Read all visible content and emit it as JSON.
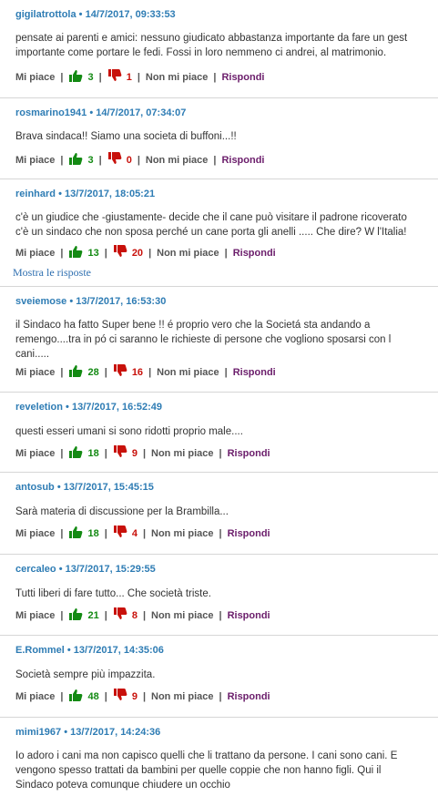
{
  "labels": {
    "like": "Mi piace",
    "dislike": "Non mi piace",
    "reply": "Rispondi",
    "separator": "•",
    "show_replies": "Mostra le risposte"
  },
  "colors": {
    "author": "#2e7cb4",
    "like": "#138a13",
    "dislike": "#c8110b",
    "reply": "#6b1d6b"
  },
  "icons": {
    "like": "thumbs-up-icon",
    "dislike": "thumbs-down-icon"
  },
  "comments": [
    {
      "author": "gigilatrottola",
      "date": "14/7/2017, 09:33:53",
      "text": "pensate ai parenti e amici: nessuno giudicato abbastanza importante da fare un gest\nimportante come portare le fedi. Fossi in loro nemmeno ci andrei, al matrimonio.",
      "likes": "3",
      "dislikes": "1"
    },
    {
      "author": "rosmarino1941",
      "date": "14/7/2017, 07:34:07",
      "text": "Brava sindaca!! Siamo una societa di buffoni...!!",
      "likes": "3",
      "dislikes": "0"
    },
    {
      "author": "reinhard",
      "date": "13/7/2017, 18:05:21",
      "text": "c'è un giudice che -giustamente- decide che il cane può visitare il padrone ricoverato\nc'è un sindaco che non sposa perché un cane porta gli anelli ..... Che dire? W l'Italia!",
      "likes": "13",
      "dislikes": "20"
    },
    {
      "author": "sveiemose",
      "date": "13/7/2017, 16:53:30",
      "text": "il Sindaco ha fatto Super bene !! é proprio vero che la Societá sta andando a\nremengo....tra in pó ci saranno le richieste di persone che vogliono sposarsi con l\ncani.....",
      "likes": "28",
      "dislikes": "16"
    },
    {
      "author": "reveletion",
      "date": "13/7/2017, 16:52:49",
      "text": "questi esseri umani si sono ridotti proprio male....",
      "likes": "18",
      "dislikes": "9"
    },
    {
      "author": "antosub",
      "date": "13/7/2017, 15:45:15",
      "text": "Sarà materia di discussione per la Brambilla...",
      "likes": "18",
      "dislikes": "4"
    },
    {
      "author": "cercaleo",
      "date": "13/7/2017, 15:29:55",
      "text": "Tutti liberi di fare tutto... Che società triste.",
      "likes": "21",
      "dislikes": "8"
    },
    {
      "author": "E.Rommel",
      "date": "13/7/2017, 14:35:06",
      "text": "Società sempre più impazzita.",
      "likes": "48",
      "dislikes": "9"
    },
    {
      "author": "mimi1967",
      "date": "13/7/2017, 14:24:36",
      "text": "Io adoro i cani ma non capisco quelli che li trattano da persone. I cani sono cani. E\nvengono spesso trattati da bambini per quelle coppie che non hanno figli. Qui il\nSindaco poteva comunque chiudere un occhio",
      "likes": "",
      "dislikes": ""
    }
  ]
}
